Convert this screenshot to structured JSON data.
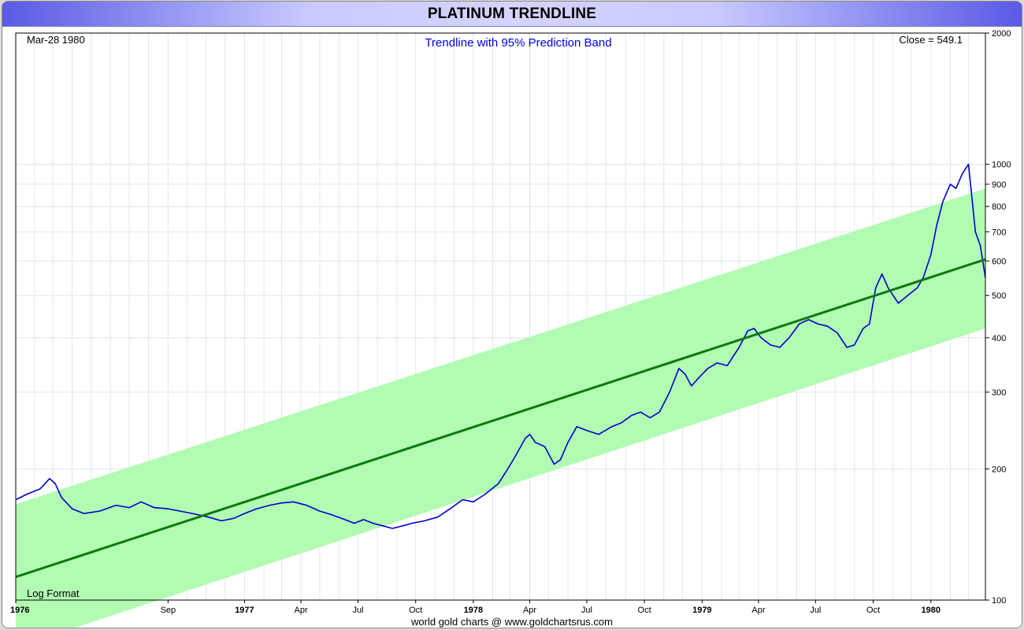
{
  "header": {
    "title": "PLATINUM TRENDLINE"
  },
  "annotations": {
    "date": "Mar-28  1980",
    "subtitle": "Trendline with 95% Prediction Band",
    "close": "Close = 549.1",
    "format": "Log Format"
  },
  "footer": {
    "credit": "world gold charts @ www.goldchartsrus.com"
  },
  "colors": {
    "price": "#0000cc",
    "trend": "#0a7a0a",
    "band": "#b2fbb2",
    "grid": "#dde8ef",
    "subtitle": "#0000ee"
  },
  "chart_data": {
    "type": "line",
    "title": "PLATINUM TRENDLINE",
    "subtitle": "Trendline with 95% Prediction Band",
    "y_scale": "log",
    "ylim": [
      100,
      2000
    ],
    "xlim": [
      "1976-01-02",
      "1980-03-28"
    ],
    "grid": true,
    "y_ticks": [
      100,
      200,
      300,
      400,
      500,
      600,
      700,
      800,
      900,
      1000,
      2000
    ],
    "x_ticks": [
      {
        "date": "1976-01-01",
        "label": "1976",
        "bold": true
      },
      {
        "date": "1976-09-01",
        "label": "Sep",
        "bold": false
      },
      {
        "date": "1977-01-01",
        "label": "1977",
        "bold": true
      },
      {
        "date": "1977-04-01",
        "label": "Apr",
        "bold": false
      },
      {
        "date": "1977-07-01",
        "label": "Jul",
        "bold": false
      },
      {
        "date": "1977-10-01",
        "label": "Oct",
        "bold": false
      },
      {
        "date": "1978-01-01",
        "label": "1978",
        "bold": true
      },
      {
        "date": "1978-04-01",
        "label": "Apr",
        "bold": false
      },
      {
        "date": "1978-07-01",
        "label": "Jul",
        "bold": false
      },
      {
        "date": "1978-10-01",
        "label": "Oct",
        "bold": false
      },
      {
        "date": "1979-01-01",
        "label": "1979",
        "bold": true
      },
      {
        "date": "1979-04-01",
        "label": "Apr",
        "bold": false
      },
      {
        "date": "1979-07-01",
        "label": "Jul",
        "bold": false
      },
      {
        "date": "1979-10-01",
        "label": "Oct",
        "bold": false
      },
      {
        "date": "1980-01-01",
        "label": "1980",
        "bold": true
      }
    ],
    "trend": {
      "start": [
        "1976-01-02",
        113
      ],
      "end": [
        "1980-03-28",
        605
      ]
    },
    "band_upper": {
      "start": [
        "1976-01-02",
        166
      ],
      "end": [
        "1980-03-28",
        880
      ]
    },
    "band_lower": {
      "start": [
        "1976-01-02",
        78
      ],
      "end": [
        "1980-03-28",
        420
      ]
    },
    "price_series": [
      [
        "1976-01-02",
        170
      ],
      [
        "1976-01-20",
        175
      ],
      [
        "1976-02-10",
        180
      ],
      [
        "1976-02-25",
        190
      ],
      [
        "1976-03-05",
        185
      ],
      [
        "1976-03-15",
        172
      ],
      [
        "1976-04-01",
        162
      ],
      [
        "1976-04-20",
        158
      ],
      [
        "1976-05-15",
        160
      ],
      [
        "1976-06-10",
        165
      ],
      [
        "1976-07-01",
        163
      ],
      [
        "1976-07-20",
        168
      ],
      [
        "1976-08-10",
        163
      ],
      [
        "1976-09-01",
        162
      ],
      [
        "1976-09-20",
        160
      ],
      [
        "1976-10-10",
        158
      ],
      [
        "1976-11-05",
        155
      ],
      [
        "1976-11-25",
        152
      ],
      [
        "1976-12-15",
        154
      ],
      [
        "1977-01-01",
        158
      ],
      [
        "1977-01-20",
        162
      ],
      [
        "1977-02-10",
        165
      ],
      [
        "1977-03-01",
        167
      ],
      [
        "1977-03-20",
        168
      ],
      [
        "1977-04-10",
        165
      ],
      [
        "1977-05-01",
        160
      ],
      [
        "1977-05-20",
        157
      ],
      [
        "1977-06-10",
        153
      ],
      [
        "1977-06-25",
        150
      ],
      [
        "1977-07-10",
        153
      ],
      [
        "1977-07-25",
        150
      ],
      [
        "1977-08-10",
        148
      ],
      [
        "1977-08-25",
        146
      ],
      [
        "1977-09-10",
        148
      ],
      [
        "1977-09-25",
        150
      ],
      [
        "1977-10-15",
        152
      ],
      [
        "1977-11-05",
        155
      ],
      [
        "1977-11-25",
        162
      ],
      [
        "1977-12-15",
        170
      ],
      [
        "1978-01-01",
        168
      ],
      [
        "1978-01-20",
        175
      ],
      [
        "1978-02-10",
        185
      ],
      [
        "1978-02-25",
        200
      ],
      [
        "1978-03-10",
        215
      ],
      [
        "1978-03-25",
        235
      ],
      [
        "1978-04-01",
        240
      ],
      [
        "1978-04-10",
        230
      ],
      [
        "1978-04-25",
        225
      ],
      [
        "1978-05-10",
        205
      ],
      [
        "1978-05-20",
        210
      ],
      [
        "1978-06-01",
        230
      ],
      [
        "1978-06-15",
        250
      ],
      [
        "1978-07-01",
        245
      ],
      [
        "1978-07-20",
        240
      ],
      [
        "1978-08-10",
        250
      ],
      [
        "1978-08-25",
        255
      ],
      [
        "1978-09-10",
        265
      ],
      [
        "1978-09-25",
        270
      ],
      [
        "1978-10-10",
        262
      ],
      [
        "1978-10-25",
        270
      ],
      [
        "1978-11-10",
        300
      ],
      [
        "1978-11-25",
        340
      ],
      [
        "1978-12-05",
        330
      ],
      [
        "1978-12-15",
        310
      ],
      [
        "1978-12-28",
        325
      ],
      [
        "1979-01-10",
        340
      ],
      [
        "1979-01-25",
        350
      ],
      [
        "1979-02-10",
        345
      ],
      [
        "1979-03-01",
        380
      ],
      [
        "1979-03-15",
        415
      ],
      [
        "1979-03-25",
        420
      ],
      [
        "1979-04-05",
        400
      ],
      [
        "1979-04-20",
        385
      ],
      [
        "1979-05-05",
        380
      ],
      [
        "1979-05-20",
        400
      ],
      [
        "1979-06-05",
        430
      ],
      [
        "1979-06-20",
        440
      ],
      [
        "1979-07-05",
        430
      ],
      [
        "1979-07-20",
        425
      ],
      [
        "1979-08-05",
        410
      ],
      [
        "1979-08-20",
        380
      ],
      [
        "1979-09-01",
        385
      ],
      [
        "1979-09-15",
        420
      ],
      [
        "1979-09-25",
        430
      ],
      [
        "1979-10-05",
        520
      ],
      [
        "1979-10-15",
        560
      ],
      [
        "1979-10-25",
        520
      ],
      [
        "1979-11-10",
        480
      ],
      [
        "1979-11-25",
        500
      ],
      [
        "1979-12-10",
        520
      ],
      [
        "1979-12-20",
        550
      ],
      [
        "1980-01-01",
        620
      ],
      [
        "1980-01-10",
        720
      ],
      [
        "1980-01-20",
        820
      ],
      [
        "1980-02-01",
        900
      ],
      [
        "1980-02-10",
        880
      ],
      [
        "1980-02-20",
        950
      ],
      [
        "1980-03-01",
        1000
      ],
      [
        "1980-03-05",
        880
      ],
      [
        "1980-03-12",
        700
      ],
      [
        "1980-03-20",
        650
      ],
      [
        "1980-03-28",
        549.1
      ]
    ]
  }
}
